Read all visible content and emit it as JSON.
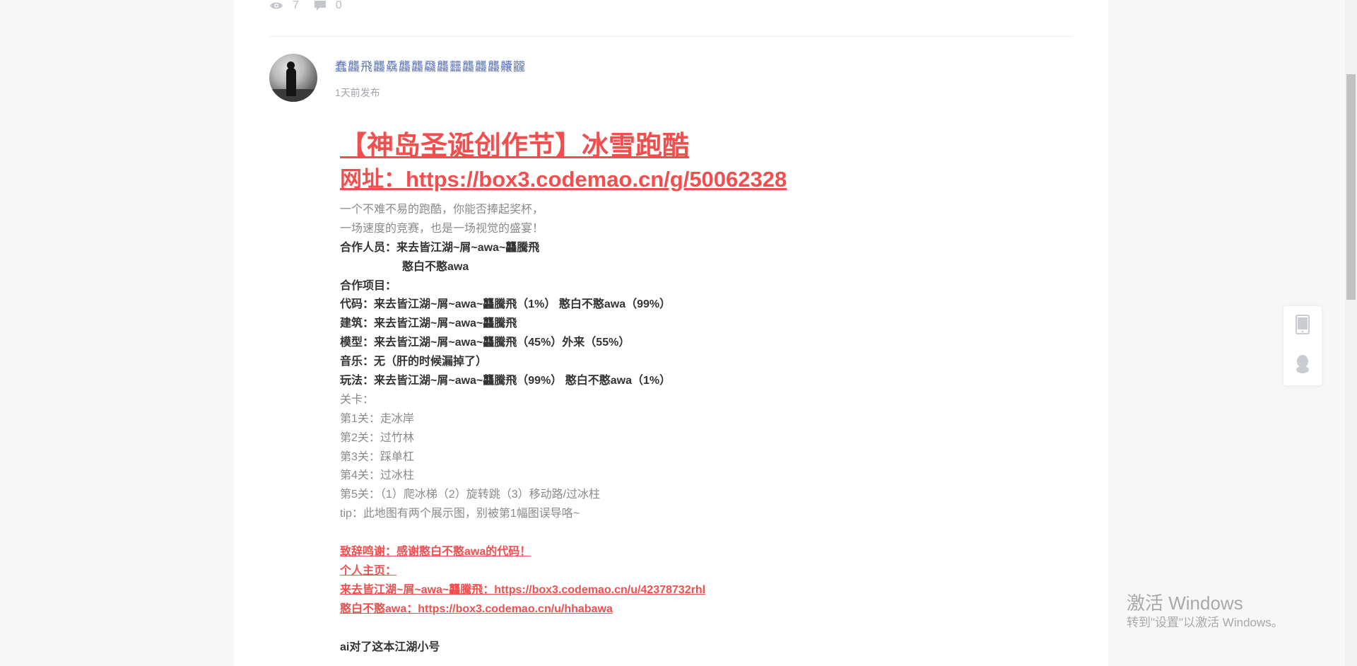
{
  "stats": {
    "views": "7",
    "comments": "0"
  },
  "author": {
    "name": "蠢龘飛龘驫龘龘飝龘䨻龘龘龘齉龖",
    "time": "1天前发布"
  },
  "post": {
    "title": "【神岛圣诞创作节】冰雪跑酷",
    "url_line": "网址：https://box3.codemao.cn/g/50062328",
    "lines": [
      {
        "text": "一个不难不易的跑酷，你能否捧起奖杯，",
        "style": "normal"
      },
      {
        "text": "一场速度的竞赛，也是一场视觉的盛宴！",
        "style": "normal"
      },
      {
        "text": "合作人员：来去皆江湖~屑~awa~龘騰飛",
        "style": "bold"
      },
      {
        "text": "憨白不憨awa",
        "style": "bold-indent"
      },
      {
        "text": "合作项目：",
        "style": "bold"
      },
      {
        "text": "代码：来去皆江湖~屑~awa~龘騰飛（1%） 憨白不憨awa（99%）",
        "style": "bold"
      },
      {
        "text": "建筑：来去皆江湖~屑~awa~龘騰飛",
        "style": "bold"
      },
      {
        "text": "模型：来去皆江湖~屑~awa~龘騰飛（45%）外来（55%）",
        "style": "bold"
      },
      {
        "text": "音乐：无（肝的时候漏掉了）",
        "style": "bold"
      },
      {
        "text": "玩法：来去皆江湖~屑~awa~龘騰飛（99%） 憨白不憨awa（1%）",
        "style": "bold"
      },
      {
        "text": "关卡：",
        "style": "normal"
      },
      {
        "text": "第1关：走冰岸",
        "style": "normal"
      },
      {
        "text": "第2关：过竹林",
        "style": "normal"
      },
      {
        "text": "第3关：踩单杠",
        "style": "normal"
      },
      {
        "text": "第4关：过冰柱",
        "style": "normal"
      },
      {
        "text": "第5关：（1）爬冰梯（2）旋转跳（3）移动路/过冰柱",
        "style": "normal"
      },
      {
        "text": "tip：此地图有两个展示图，别被第1幅图误导咯~",
        "style": "normal"
      },
      {
        "text": "",
        "style": "gap"
      },
      {
        "text": "致辞鸣谢：感谢憨白不憨awa的代码！",
        "style": "red"
      },
      {
        "text": "个人主页：",
        "style": "red"
      },
      {
        "text": "来去皆江湖~屑~awa~龘騰飛：https://box3.codemao.cn/u/42378732rhl",
        "style": "red"
      },
      {
        "text": "憨白不憨awa：https://box3.codemao.cn/u/hhabawa",
        "style": "red"
      },
      {
        "text": "",
        "style": "gap"
      },
      {
        "text": "ai对了这本江湖小号",
        "style": "bold"
      }
    ]
  },
  "sidebar": {
    "items": [
      {
        "icon": "tablet-icon"
      },
      {
        "icon": "qq-penguin-icon"
      }
    ]
  },
  "watermark": {
    "line1": "激活 Windows",
    "line2": "转到\"设置\"以激活 Windows。"
  },
  "colors": {
    "accent_red": "#f24e4e",
    "author_blue": "#5a74b8"
  }
}
